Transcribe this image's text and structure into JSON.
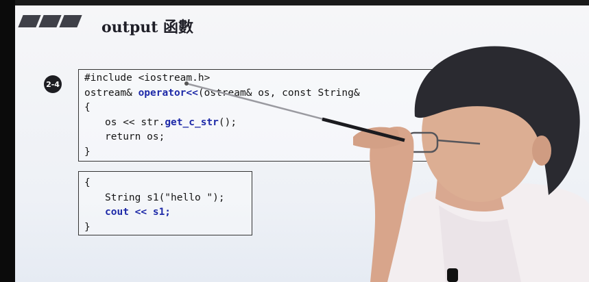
{
  "slide": {
    "title": "output 函數",
    "badge": "2-4"
  },
  "code_block_1": {
    "lines": [
      {
        "parts": [
          {
            "text": "#include <iostream.h>",
            "kw": false
          }
        ]
      },
      {
        "parts": [
          {
            "text": "ostream& ",
            "kw": false
          },
          {
            "text": "operator<<",
            "kw": true
          },
          {
            "text": "(ostream& os, const String&",
            "kw": false
          }
        ]
      },
      {
        "parts": [
          {
            "text": "{",
            "kw": false
          }
        ]
      },
      {
        "indent": true,
        "parts": [
          {
            "text": "os << str.",
            "kw": false
          },
          {
            "text": "get_c_str",
            "kw": true
          },
          {
            "text": "();",
            "kw": false
          }
        ]
      },
      {
        "indent": true,
        "parts": [
          {
            "text": "return os;",
            "kw": false
          }
        ]
      },
      {
        "parts": [
          {
            "text": "}",
            "kw": false
          }
        ]
      }
    ]
  },
  "code_block_2": {
    "lines": [
      {
        "parts": [
          {
            "text": "{",
            "kw": false
          }
        ]
      },
      {
        "indent": true,
        "parts": [
          {
            "text": "String s1(\"hello \");",
            "kw": false
          }
        ]
      },
      {
        "indent": true,
        "parts": [
          {
            "text": "cout << s1;",
            "kw": true
          }
        ]
      },
      {
        "parts": [
          {
            "text": "}",
            "kw": false
          }
        ]
      }
    ]
  },
  "colors": {
    "keyword": "#1e2aa8",
    "background": "#f4f4f6",
    "badge": "#1d1d22"
  }
}
